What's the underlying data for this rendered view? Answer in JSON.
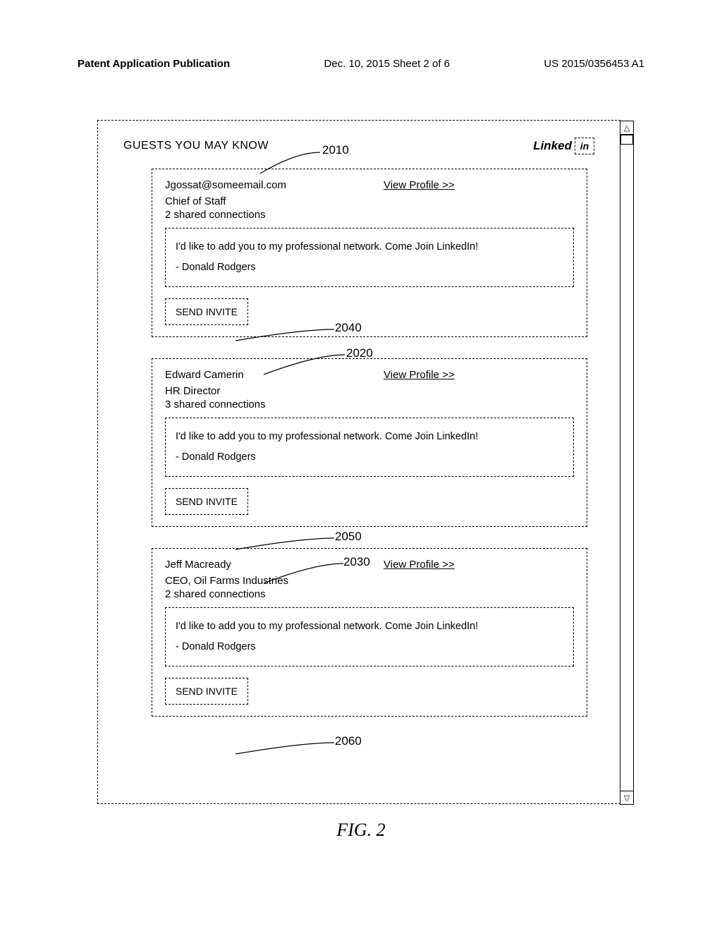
{
  "header": {
    "left": "Patent Application Publication",
    "center": "Dec. 10, 2015  Sheet 2 of 6",
    "right": "US 2015/0356453 A1"
  },
  "panel": {
    "title": "GUESTS YOU MAY KNOW",
    "logo_text": "Linked",
    "logo_box": "in"
  },
  "cards": [
    {
      "name": "Jgossat@someemail.com",
      "view": "View Profile >>",
      "role": "Chief of Staff",
      "shared": "2 shared connections",
      "msg_line1": "I'd like to add you to my professional network.  Come Join LinkedIn!",
      "msg_line2": "- Donald Rodgers",
      "button": "SEND INVITE"
    },
    {
      "name": "Edward Camerin",
      "view": "View Profile >>",
      "role": "HR Director",
      "shared": "3 shared connections",
      "msg_line1": "I'd like to add you to my professional network.  Come Join LinkedIn!",
      "msg_line2": "- Donald Rodgers",
      "button": "SEND INVITE"
    },
    {
      "name": "Jeff Macready",
      "view": "View Profile >>",
      "role": "CEO, Oil Farms Industries",
      "shared": "2 shared connections",
      "msg_line1": "I'd like to add you to my professional network.  Come Join LinkedIn!",
      "msg_line2": "- Donald Rodgers",
      "button": "SEND INVITE"
    }
  ],
  "refs": {
    "r2010": "2010",
    "r2020": "2020",
    "r2030": "2030",
    "r2040": "2040",
    "r2050": "2050",
    "r2060": "2060"
  },
  "caption": "FIG. 2"
}
